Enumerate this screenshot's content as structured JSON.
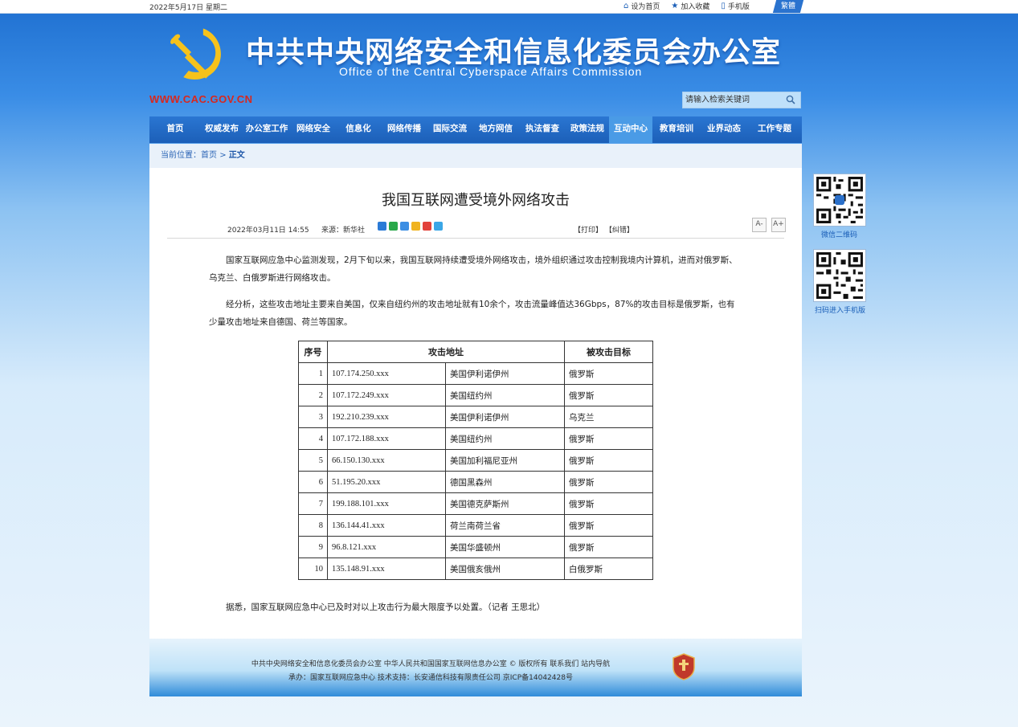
{
  "topbar": {
    "date": "2022年5月17日 星期二",
    "home_label": "设为首页",
    "favorite_label": "加入收藏",
    "mobile_label": "手机版",
    "traditional_label": "繁體"
  },
  "header": {
    "title": "中共中央网络安全和信息化委员会办公室",
    "subtitle": "Office of the Central Cyberspace Affairs Commission",
    "url": "WWW.CAC.GOV.CN",
    "search_placeholder": "请输入检索关键词"
  },
  "nav": [
    {
      "label": "首页"
    },
    {
      "label": "权威发布"
    },
    {
      "label": "办公室工作"
    },
    {
      "label": "网络安全"
    },
    {
      "label": "信息化"
    },
    {
      "label": "网络传播"
    },
    {
      "label": "国际交流"
    },
    {
      "label": "地方网信"
    },
    {
      "label": "执法督查"
    },
    {
      "label": "政策法规"
    },
    {
      "label": "互动中心"
    },
    {
      "label": "教育培训"
    },
    {
      "label": "业界动态"
    },
    {
      "label": "工作专题"
    }
  ],
  "nav_active": "互动中心",
  "breadcrumb": {
    "prefix": "当前位置：",
    "home": "首页",
    "sep": ">",
    "current": "正文"
  },
  "article": {
    "title": "我国互联网遭受境外网络攻击",
    "datetime": "2022年03月11日 14:55",
    "source": "来源：新华社",
    "print": "【打印】",
    "correct": "【纠错】",
    "font_small": "A-",
    "font_large": "A+",
    "para1": "国家互联网应急中心监测发现，2月下旬以来，我国互联网持续遭受境外网络攻击，境外组织通过攻击控制我境内计算机，进而对俄罗斯、乌克兰、白俄罗斯进行网络攻击。",
    "para2": "经分析，这些攻击地址主要来自美国，仅来自纽约州的攻击地址就有10余个，攻击流量峰值达36Gbps，87%的攻击目标是俄罗斯，也有少量攻击地址来自德国、荷兰等国家。",
    "para3": "据悉，国家互联网应急中心已及时对以上攻击行为最大限度予以处置。（记者 王思北）"
  },
  "table": {
    "headers": [
      "序号",
      "攻击地址",
      "被攻击目标"
    ],
    "rows": [
      [
        "1",
        "107.174.250.xxx",
        "美国伊利诺伊州",
        "俄罗斯"
      ],
      [
        "2",
        "107.172.249.xxx",
        "美国纽约州",
        "俄罗斯"
      ],
      [
        "3",
        "192.210.239.xxx",
        "美国伊利诺伊州",
        "乌克兰"
      ],
      [
        "4",
        "107.172.188.xxx",
        "美国纽约州",
        "俄罗斯"
      ],
      [
        "5",
        "66.150.130.xxx",
        "美国加利福尼亚州",
        "俄罗斯"
      ],
      [
        "6",
        "51.195.20.xxx",
        "德国黑森州",
        "俄罗斯"
      ],
      [
        "7",
        "199.188.101.xxx",
        "美国德克萨斯州",
        "俄罗斯"
      ],
      [
        "8",
        "136.144.41.xxx",
        "荷兰南荷兰省",
        "俄罗斯"
      ],
      [
        "9",
        "96.8.121.xxx",
        "美国华盛顿州",
        "俄罗斯"
      ],
      [
        "10",
        "135.148.91.xxx",
        "美国俄亥俄州",
        "白俄罗斯"
      ]
    ]
  },
  "footer": {
    "line1": "中共中央网络安全和信息化委员会办公室  中华人民共和国国家互联网信息办公室 © 版权所有  联系我们  站内导航",
    "line2": "承办：国家互联网应急中心  技术支持：长安通信科技有限责任公司  京ICP备14042428号"
  },
  "side": {
    "qr1_caption": "微信二维码",
    "qr2_caption": "扫码进入手机版"
  },
  "colors": {
    "nav_bg": "#1c5fb8",
    "nav_active": "#4a9be6",
    "url_red": "#d9271c",
    "link_blue": "#2a64b5"
  }
}
